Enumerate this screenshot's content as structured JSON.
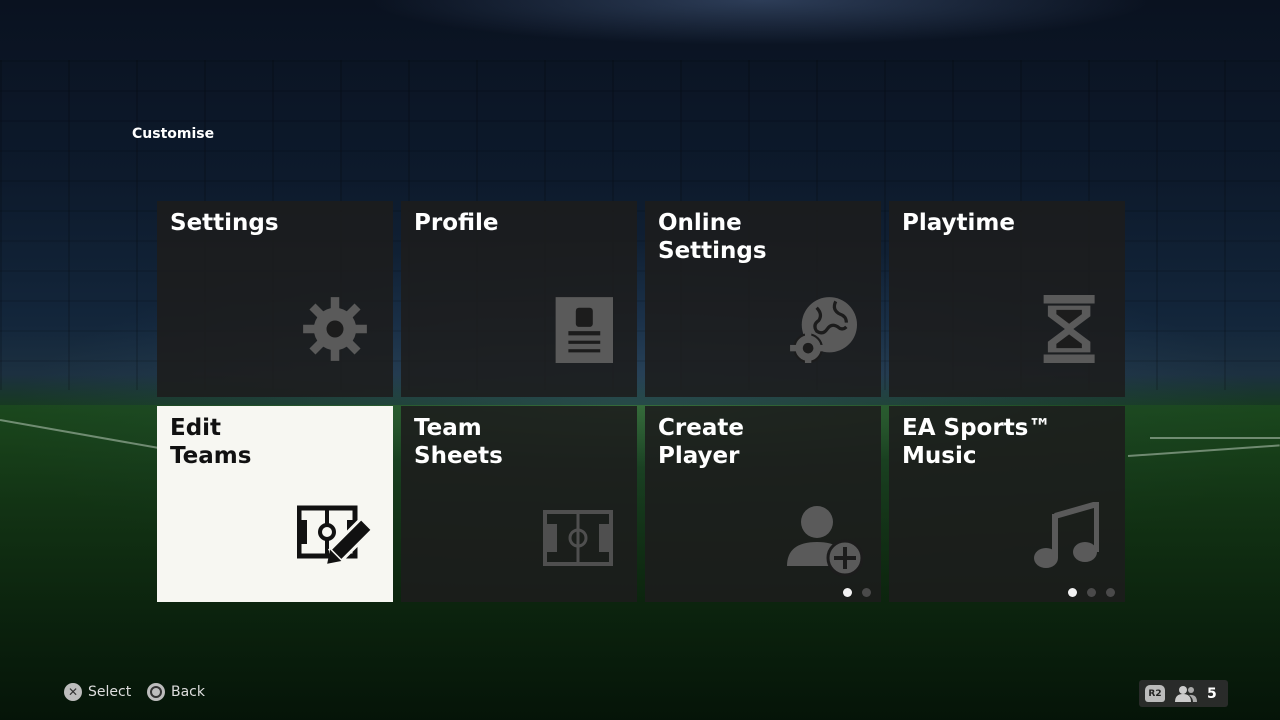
{
  "section_title": "Customise",
  "tiles": [
    {
      "label": "Settings",
      "icon": "gear-icon"
    },
    {
      "label": "Profile",
      "icon": "profile-card-icon"
    },
    {
      "label": "Online\nSettings",
      "icon": "globe-gear-icon"
    },
    {
      "label": "Playtime",
      "icon": "hourglass-icon"
    },
    {
      "label": "Edit\nTeams",
      "icon": "pitch-edit-icon",
      "selected": true
    },
    {
      "label": "Team\nSheets",
      "icon": "pitch-icon"
    },
    {
      "label": "Create\nPlayer",
      "icon": "add-player-icon",
      "pages": 2,
      "current_page": 1
    },
    {
      "label": "EA Sports™\nMusic",
      "icon": "music-note-icon",
      "pages": 3,
      "current_page": 1
    }
  ],
  "footer": {
    "select_label": "Select",
    "back_label": "Back",
    "r2_label": "R2",
    "party_count": "5"
  }
}
